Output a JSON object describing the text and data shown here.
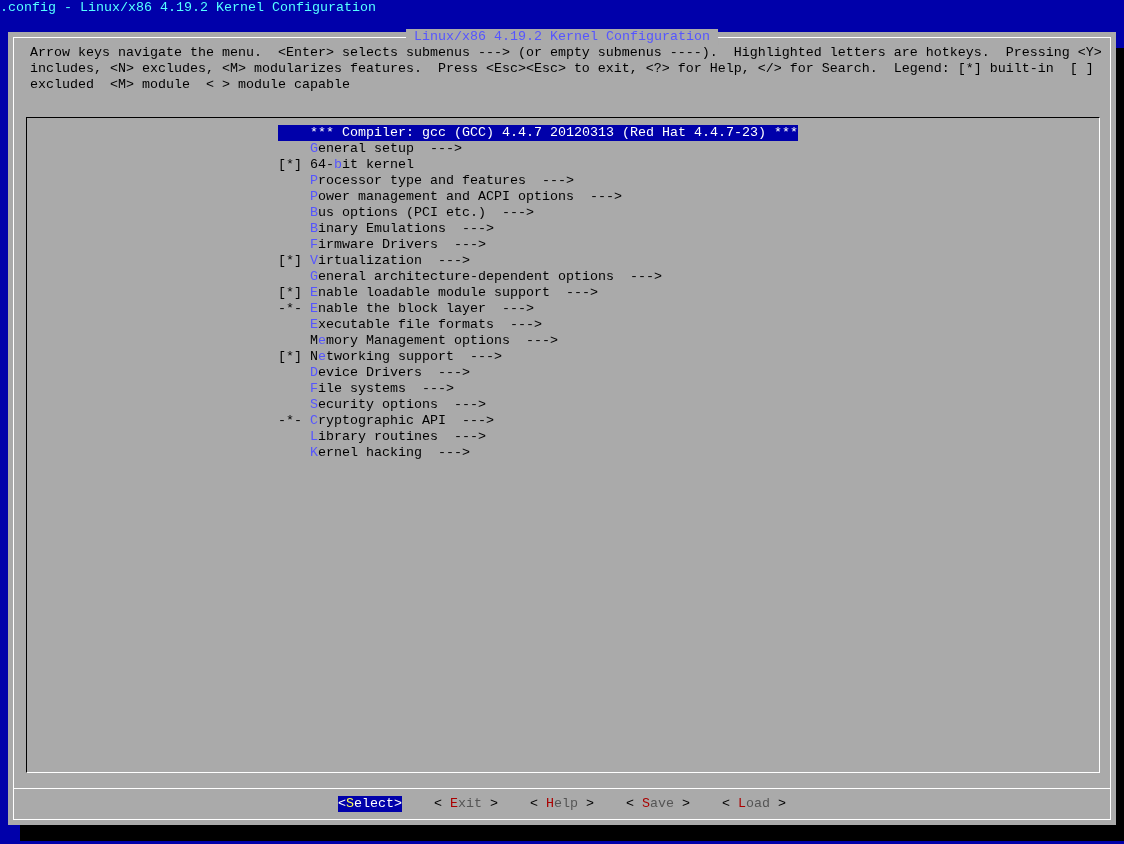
{
  "window": {
    "title": ".config - Linux/x86 4.19.2 Kernel Configuration"
  },
  "dialog": {
    "title": "Linux/x86 4.19.2 Kernel Configuration",
    "help_lines": [
      "Arrow keys navigate the menu.  <Enter> selects submenus ---> (or empty submenus ----).  Highlighted letters are hotkeys.  Pressing <Y>",
      "includes, <N> excludes, <M> modularizes features.  Press <Esc><Esc> to exit, <?> for Help, </> for Search.  Legend: [*] built-in  [ ]",
      "excluded  <M> module  < > module capable"
    ]
  },
  "menu": {
    "items": [
      {
        "kind": "comment",
        "text": "*** Compiler: gcc (GCC) 4.4.7 20120313 (Red Hat 4.4.7-23) ***",
        "selected": true
      },
      {
        "kind": "entry",
        "hotkey": "G",
        "rest": "eneral setup",
        "submenu": "--->",
        "selected": false
      },
      {
        "kind": "entry",
        "prefix": "[*]",
        "lead": "64-",
        "hotkey": "b",
        "rest": "it kernel",
        "selected": false
      },
      {
        "kind": "entry",
        "hotkey": "P",
        "rest": "rocessor type and features",
        "submenu": "--->",
        "selected": false
      },
      {
        "kind": "entry",
        "hotkey": "P",
        "rest": "ower management and ACPI options",
        "submenu": "--->",
        "selected": false
      },
      {
        "kind": "entry",
        "hotkey": "B",
        "rest": "us options (PCI etc.)",
        "submenu": "--->",
        "selected": false
      },
      {
        "kind": "entry",
        "hotkey": "B",
        "rest": "inary Emulations",
        "submenu": "--->",
        "selected": false
      },
      {
        "kind": "entry",
        "hotkey": "F",
        "rest": "irmware Drivers",
        "submenu": "--->",
        "selected": false
      },
      {
        "kind": "entry",
        "prefix": "[*]",
        "hotkey": "V",
        "rest": "irtualization",
        "submenu": "--->",
        "selected": false
      },
      {
        "kind": "entry",
        "hotkey": "G",
        "rest": "eneral architecture-dependent options",
        "submenu": "--->",
        "selected": false
      },
      {
        "kind": "entry",
        "prefix": "[*]",
        "hotkey": "E",
        "rest": "nable loadable module support",
        "submenu": "--->",
        "selected": false
      },
      {
        "kind": "entry",
        "prefix": "-*-",
        "hotkey": "E",
        "rest": "nable the block layer",
        "submenu": "--->",
        "selected": false
      },
      {
        "kind": "entry",
        "hotkey": "E",
        "rest": "xecutable file formats",
        "submenu": "--->",
        "selected": false
      },
      {
        "kind": "entry",
        "lead": "M",
        "hotkey": "e",
        "rest": "mory Management options",
        "submenu": "--->",
        "selected": false
      },
      {
        "kind": "entry",
        "prefix": "[*]",
        "lead": "N",
        "hotkey": "e",
        "rest": "tworking support",
        "submenu": "--->",
        "selected": false
      },
      {
        "kind": "entry",
        "hotkey": "D",
        "rest": "evice Drivers",
        "submenu": "--->",
        "selected": false
      },
      {
        "kind": "entry",
        "hotkey": "F",
        "rest": "ile systems",
        "submenu": "--->",
        "selected": false
      },
      {
        "kind": "entry",
        "hotkey": "S",
        "rest": "ecurity options",
        "submenu": "--->",
        "selected": false
      },
      {
        "kind": "entry",
        "prefix": "-*-",
        "hotkey": "C",
        "rest": "ryptographic API",
        "submenu": "--->",
        "selected": false
      },
      {
        "kind": "entry",
        "hotkey": "L",
        "rest": "ibrary routines",
        "submenu": "--->",
        "selected": false
      },
      {
        "kind": "entry",
        "hotkey": "K",
        "rest": "ernel hacking",
        "submenu": "--->",
        "selected": false
      }
    ]
  },
  "buttons": [
    {
      "open": "<",
      "hotkey": "S",
      "rest": "elect",
      "close": ">",
      "selected": true
    },
    {
      "open": "< ",
      "hotkey": "E",
      "rest": "xit",
      "close": " >",
      "selected": false
    },
    {
      "open": "< ",
      "hotkey": "H",
      "rest": "elp",
      "close": " >",
      "selected": false
    },
    {
      "open": "< ",
      "hotkey": "S",
      "rest": "ave",
      "close": " >",
      "selected": false
    },
    {
      "open": "< ",
      "hotkey": "L",
      "rest": "oad",
      "close": " >",
      "selected": false
    }
  ]
}
